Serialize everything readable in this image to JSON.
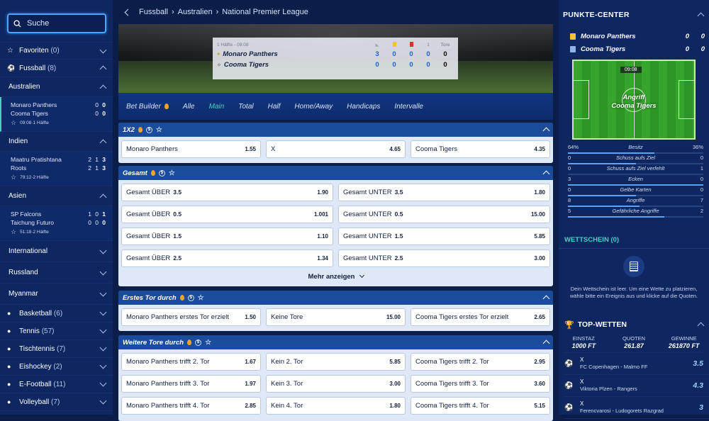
{
  "search": {
    "placeholder": "Suche"
  },
  "sidebar": {
    "favorites": {
      "label": "Favoriten",
      "count": "(0)"
    },
    "fussball": {
      "label": "Fussball",
      "count": "(8)"
    },
    "regions": [
      {
        "name": "Australien",
        "matches": [
          {
            "home": "Monaro Panthers",
            "away": "Cooma Tigers",
            "hs1": "0",
            "hs2": "0",
            "as1": "0",
            "as2": "0",
            "time": "09:08·1 Hälfte"
          }
        ]
      },
      {
        "name": "Indien",
        "matches": [
          {
            "home": "Maatru Pratishtana",
            "away": "Roots",
            "hs1": "2",
            "hs2": "1",
            "hs3": "3",
            "as1": "2",
            "as2": "1",
            "as3": "3",
            "time": "79:12·2 Hälfte"
          }
        ]
      },
      {
        "name": "Asien",
        "matches": [
          {
            "home": "SP Falcons",
            "away": "Taichung Futuro",
            "hs1": "1",
            "hs2": "0",
            "hs3": "1",
            "as1": "0",
            "as2": "0",
            "as3": "0",
            "time": "51:18·2 Hälfte"
          }
        ]
      }
    ],
    "more_regions": [
      "International",
      "Russland",
      "Myanmar"
    ],
    "sports": [
      {
        "label": "Basketball",
        "count": "(6)"
      },
      {
        "label": "Tennis",
        "count": "(57)"
      },
      {
        "label": "Tischtennis",
        "count": "(7)"
      },
      {
        "label": "Eishockey",
        "count": "(2)"
      },
      {
        "label": "E-Football",
        "count": "(11)"
      },
      {
        "label": "Volleyball",
        "count": "(7)"
      }
    ]
  },
  "breadcrumb": {
    "a": "Fussball",
    "b": "Australien",
    "c": "National Premier League"
  },
  "scoreboard": {
    "period": "1 Hälfte - 09:08",
    "total_label": "Tore",
    "col_i": "1",
    "teams": [
      {
        "name": "Monaro Panthers",
        "c1": "3",
        "c2": "0",
        "c3": "0",
        "c4": "0",
        "tot": "0"
      },
      {
        "name": "Cooma Tigers",
        "c1": "0",
        "c2": "0",
        "c3": "0",
        "c4": "0",
        "tot": "0"
      }
    ]
  },
  "tabs": [
    "Bet Builder",
    "Alle",
    "Main",
    "Total",
    "Half",
    "Home/Away",
    "Handicaps",
    "Intervalle"
  ],
  "markets": {
    "m1x2": {
      "title": "1X2",
      "odds": [
        [
          "Monaro Panthers",
          "",
          "1.55"
        ],
        [
          "X",
          "",
          "4.65"
        ],
        [
          "Cooma Tigers",
          "",
          "4.35"
        ]
      ]
    },
    "gesamt": {
      "title": "Gesamt",
      "rows": [
        [
          [
            "Gesamt ÜBER",
            "3.5",
            "1.90"
          ],
          [
            "Gesamt UNTER",
            "3.5",
            "1.80"
          ]
        ],
        [
          [
            "Gesamt ÜBER",
            "0.5",
            "1.001"
          ],
          [
            "Gesamt UNTER",
            "0.5",
            "15.00"
          ]
        ],
        [
          [
            "Gesamt ÜBER",
            "1.5",
            "1.10"
          ],
          [
            "Gesamt UNTER",
            "1.5",
            "5.85"
          ]
        ],
        [
          [
            "Gesamt ÜBER",
            "2.5",
            "1.34"
          ],
          [
            "Gesamt UNTER",
            "2.5",
            "3.00"
          ]
        ]
      ],
      "more": "Mehr anzeigen"
    },
    "erstes": {
      "title": "Erstes Tor durch",
      "odds": [
        [
          "Monaro Panthers erstes Tor erzielt",
          "",
          "1.50"
        ],
        [
          "Keine Tore",
          "",
          "15.00"
        ],
        [
          "Cooma Tigers erstes Tor erzielt",
          "",
          "2.65"
        ]
      ]
    },
    "weitere": {
      "title": "Weitere Tore durch",
      "rows": [
        [
          [
            "Monaro Panthers trifft 2. Tor",
            "",
            "1.67"
          ],
          [
            "Kein 2. Tor",
            "",
            "5.85"
          ],
          [
            "Cooma Tigers trifft 2. Tor",
            "",
            "2.95"
          ]
        ],
        [
          [
            "Monaro Panthers trifft 3. Tor",
            "",
            "1.97"
          ],
          [
            "Kein 3. Tor",
            "",
            "3.00"
          ],
          [
            "Cooma Tigers trifft 3. Tor",
            "",
            "3.60"
          ]
        ],
        [
          [
            "Monaro Panthers trifft 4. Tor",
            "",
            "2.85"
          ],
          [
            "Kein 4. Tor",
            "",
            "1.80"
          ],
          [
            "Cooma Tigers trifft 4. Tor",
            "",
            "5.15"
          ]
        ]
      ]
    }
  },
  "punkte": {
    "title": "PUNKTE-CENTER",
    "teams": [
      {
        "name": "Monaro Panthers",
        "s1": "0",
        "s2": "0",
        "color": "#f4c430"
      },
      {
        "name": "Cooma Tigers",
        "s1": "0",
        "s2": "0",
        "color": "#8fb4e8"
      }
    ],
    "field_time": "09:08",
    "field_text1": "Angriff",
    "field_text2": "Cooma Tigers",
    "stats": [
      {
        "l": "64%",
        "c": "Besitz",
        "r": "36%",
        "p": 0.64
      },
      {
        "l": "0",
        "c": "Schuss aufs Ziel",
        "r": "0",
        "p": 0.5
      },
      {
        "l": "0",
        "c": "Schuss aufs Ziel verfehlt",
        "r": "1",
        "p": 0.0
      },
      {
        "l": "3",
        "c": "Ecken",
        "r": "0",
        "p": 1.0
      },
      {
        "l": "0",
        "c": "Gelbe Karten",
        "r": "0",
        "p": 0.5
      },
      {
        "l": "8",
        "c": "Angriffe",
        "r": "7",
        "p": 0.53
      },
      {
        "l": "5",
        "c": "Gefährliche Angriffe",
        "r": "2",
        "p": 0.71
      }
    ]
  },
  "wettschein": {
    "title": "WETTSCHEIN (0)",
    "empty": "Dein Wettschein ist leer. Um eine Wette zu platzieren, wähle bitte ein Ereignis aus und klicke auf die Quoten."
  },
  "topwetten": {
    "title": "TOP-WETTEN",
    "cols": [
      {
        "k": "EINSTAZ",
        "v": "1000 FT"
      },
      {
        "k": "QUOTEN",
        "v": "261.87"
      },
      {
        "k": "GEWINNE",
        "v": "261870 FT"
      }
    ],
    "items": [
      {
        "pick": "X",
        "match": "FC Copenhagen - Malmo FF",
        "q": "3.5"
      },
      {
        "pick": "X",
        "match": "Viktoria Plzen - Rangers",
        "q": "4.3"
      },
      {
        "pick": "X",
        "match": "Ferencvarosi - Ludogorets Razgrad",
        "q": "3"
      }
    ]
  }
}
